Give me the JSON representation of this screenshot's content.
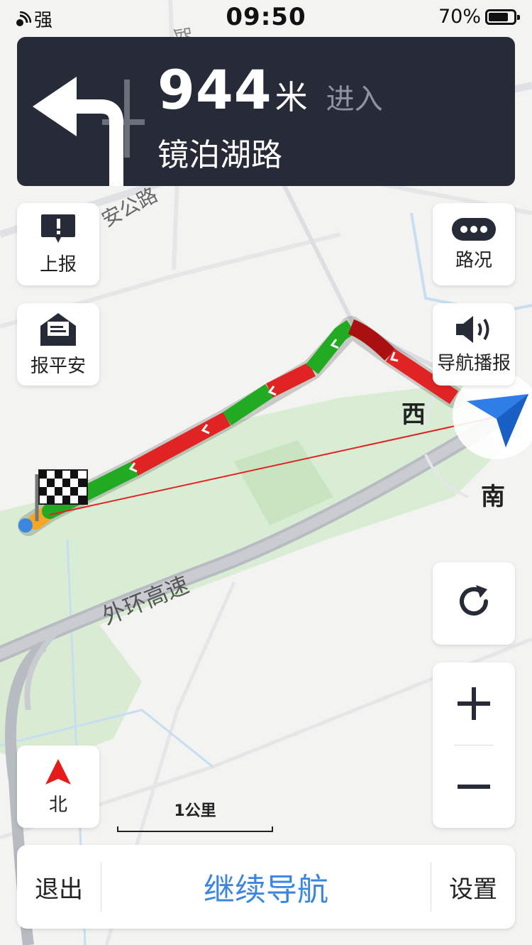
{
  "status_bar": {
    "signal": "强",
    "time": "09:50",
    "battery": "70%"
  },
  "guidance": {
    "distance": "944",
    "unit": "米",
    "action": "进入",
    "road": "镜泊湖路"
  },
  "map": {
    "roads": [
      "安公路",
      "路",
      "外环高速"
    ],
    "compass": {
      "west": "西",
      "south": "南"
    },
    "scale": "1公里"
  },
  "buttons": {
    "report": "上报",
    "safety": "报平安",
    "traffic": "路况",
    "voice": "导航播报",
    "north": "北"
  },
  "bottom": {
    "exit": "退出",
    "continue": "继续导航",
    "settings": "设置"
  },
  "colors": {
    "accent": "#3a86e0",
    "route_green": "#22aa22",
    "route_red": "#e02424",
    "route_dark_red": "#aa1010"
  }
}
